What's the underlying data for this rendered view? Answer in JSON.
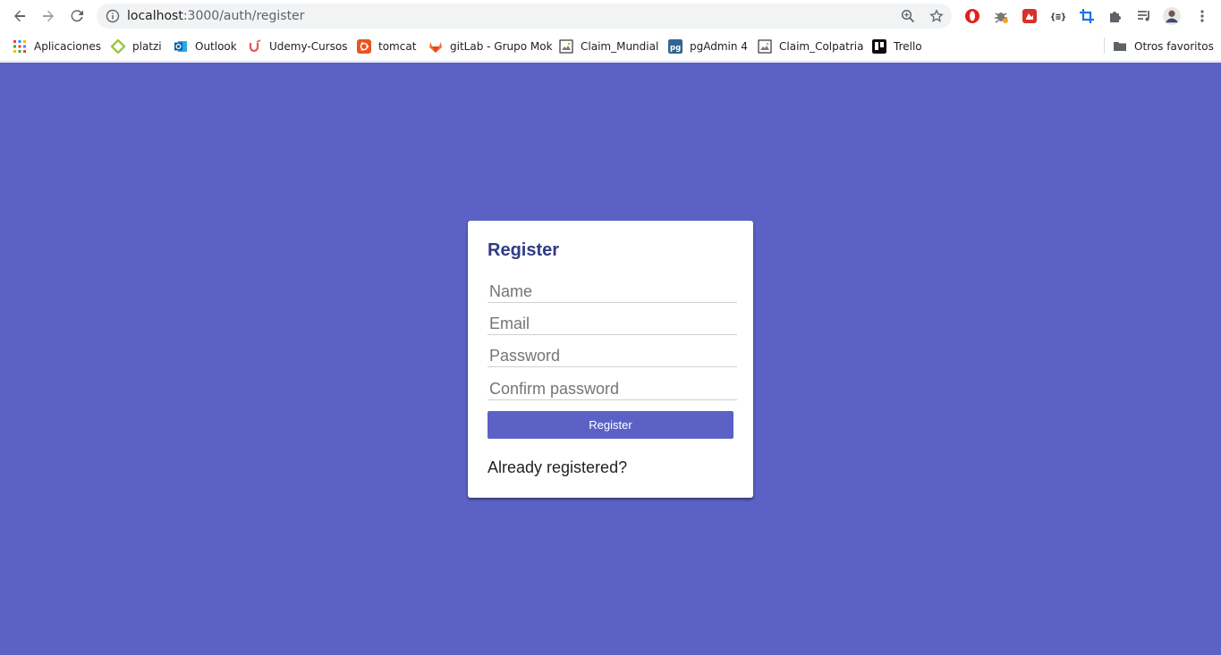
{
  "browser": {
    "url_host": "localhost",
    "url_path": ":3000/auth/register",
    "icons": {
      "back": "arrow-left-icon",
      "forward": "arrow-right-icon",
      "reload": "reload-icon",
      "info": "info-icon",
      "zoom": "zoom-icon",
      "star": "star-icon",
      "menu": "kebab-menu-icon"
    },
    "extensions": [
      "opera-extension-icon",
      "bug-extension-icon",
      "red-extension-icon",
      "json-extension-icon",
      "crop-extension-icon",
      "puzzle-extensions-icon",
      "playlist-icon",
      "profile-avatar"
    ]
  },
  "bookmarks": {
    "items": [
      {
        "label": "Aplicaciones",
        "icon": "apps-grid-icon"
      },
      {
        "label": "platzi",
        "icon": "platzi-icon"
      },
      {
        "label": "Outlook",
        "icon": "outlook-icon"
      },
      {
        "label": "Udemy-Cursos",
        "icon": "udemy-icon"
      },
      {
        "label": "tomcat",
        "icon": "ubuntu-icon"
      },
      {
        "label": "gitLab - Grupo Mok",
        "icon": "gitlab-icon"
      },
      {
        "label": "Claim_Mundial",
        "icon": "image-icon"
      },
      {
        "label": "pgAdmin 4",
        "icon": "pgadmin-icon"
      },
      {
        "label": "Claim_Colpatria",
        "icon": "image-icon"
      },
      {
        "label": "Trello",
        "icon": "trello-icon"
      }
    ],
    "other_label": "Otros favoritos"
  },
  "form": {
    "title": "Register",
    "name_placeholder": "Name",
    "email_placeholder": "Email",
    "password_placeholder": "Password",
    "confirm_placeholder": "Confirm password",
    "submit_label": "Register",
    "login_link": "Already registered?"
  },
  "colors": {
    "background": "#5c62c5",
    "title": "#2f3b87",
    "button": "#5c62c5"
  }
}
